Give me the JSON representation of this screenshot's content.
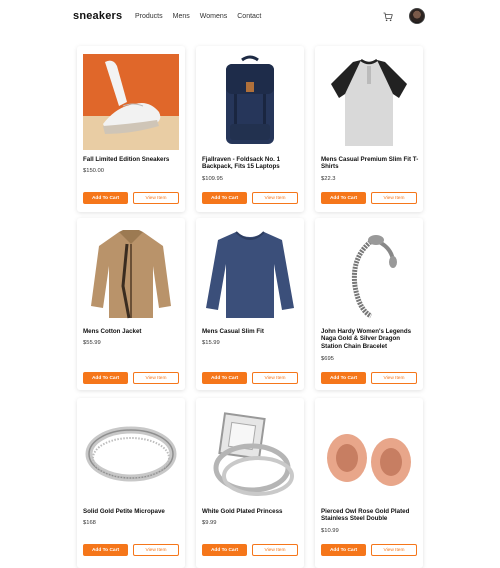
{
  "navbar": {
    "brand": "sneakers",
    "links": [
      "Products",
      "Mens",
      "Womens",
      "Contact"
    ],
    "cart_icon": "cart-icon",
    "avatar": "user-avatar"
  },
  "products": [
    {
      "title": "Fall Limited Edition Sneakers",
      "price": "$150.00",
      "add_label": "Add To Cart",
      "view_label": "View Item"
    },
    {
      "title": "Fjallraven - Foldsack No. 1 Backpack, Fits 15 Laptops",
      "price": "$109.95",
      "add_label": "Add To Cart",
      "view_label": "View Item"
    },
    {
      "title": "Mens Casual Premium Slim Fit T-Shirts",
      "price": "$22.3",
      "add_label": "Add To Cart",
      "view_label": "View Item"
    },
    {
      "title": "Mens Cotton Jacket",
      "price": "$55.99",
      "add_label": "Add To Cart",
      "view_label": "View Item"
    },
    {
      "title": "Mens Casual Slim Fit",
      "price": "$15.99",
      "add_label": "Add To Cart",
      "view_label": "View Item"
    },
    {
      "title": "John Hardy Women's Legends Naga Gold & Silver Dragon Station Chain Bracelet",
      "price": "$695",
      "add_label": "Add To Cart",
      "view_label": "View Item"
    },
    {
      "title": "Solid Gold Petite Micropave",
      "price": "$168",
      "add_label": "Add To Cart",
      "view_label": "View Item"
    },
    {
      "title": "White Gold Plated Princess",
      "price": "$9.99",
      "add_label": "Add To Cart",
      "view_label": "View Item"
    },
    {
      "title": "Pierced Owl Rose Gold Plated Stainless Steel Double",
      "price": "$10.99",
      "add_label": "Add To Cart",
      "view_label": "View Item"
    }
  ],
  "colors": {
    "accent": "#f5761a",
    "background": "#ffffff",
    "text": "#111111"
  }
}
